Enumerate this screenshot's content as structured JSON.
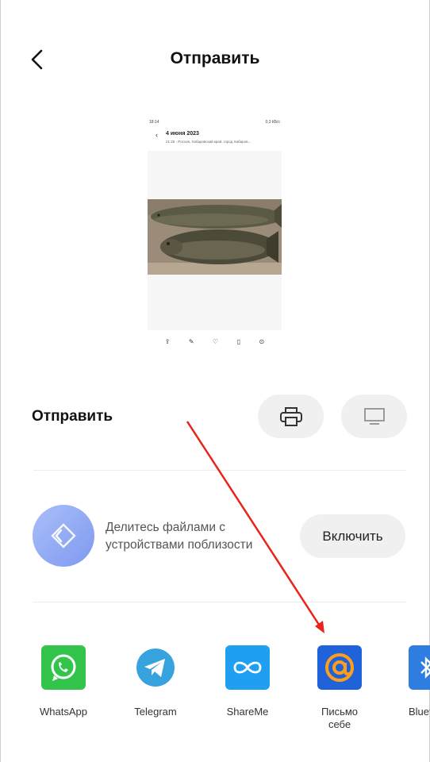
{
  "header": {
    "title": "Отправить"
  },
  "preview": {
    "status_time": "18:14",
    "status_right": "0,3 КБ/с",
    "date": "4 июня 2023",
    "location": "21:25 · Россия, Хабаровский край, город Хабаров..."
  },
  "send_section": {
    "title": "Отправить",
    "print_icon": "printer-icon",
    "screen_icon": "monitor-icon"
  },
  "nearby": {
    "text": "Делитесь файлами с устройствами поблизости",
    "button_label": "Включить"
  },
  "apps": [
    {
      "label": "WhatsApp",
      "color": "#33c44b"
    },
    {
      "label": "Telegram",
      "color": "#36a2de"
    },
    {
      "label": "ShareMe",
      "color": "#1e9ff2"
    },
    {
      "label": "Письмо себе",
      "color": "#1f62d9"
    },
    {
      "label": "Bluetooth",
      "color": "#2f7de0"
    }
  ],
  "colors": {
    "accent_arrow": "#e8241c",
    "mail_at_orange": "#ff9e1a"
  }
}
